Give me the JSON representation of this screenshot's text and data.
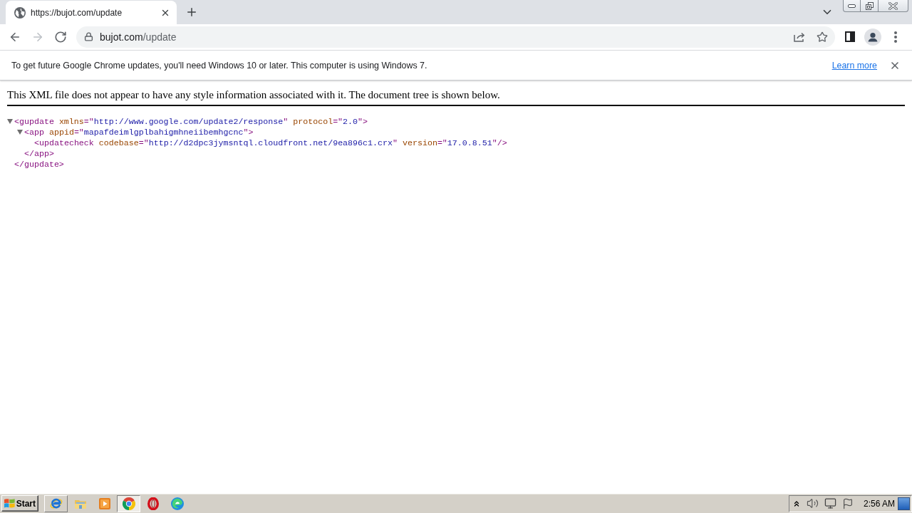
{
  "browser": {
    "tabs": [
      {
        "title": "https://bujot.com/update",
        "selected": true
      }
    ],
    "nav_buttons": [
      {
        "kind": "back",
        "disabled": false
      },
      {
        "kind": "forward",
        "disabled": true
      },
      {
        "kind": "reload",
        "disabled": false
      }
    ],
    "address_bar": {
      "host": "bujot.com",
      "path": "/update"
    }
  },
  "infobar": {
    "message": "To get future Google Chrome updates, you'll need Windows 10 or later. This computer is using Windows 7.",
    "link": "Learn more"
  },
  "page": {
    "notice": "This XML file does not appear to have any style information associated with it. The document tree is shown below.",
    "xml_tree": [
      {
        "expanded": true,
        "open_tag": [
          {
            "kind": "tag",
            "text": "<gupdate"
          },
          {
            "kind": "attr_name",
            "text": " xmlns"
          },
          {
            "kind": "tag",
            "text": "=\""
          },
          {
            "kind": "attr_value",
            "text": "http://www.google.com/update2/response"
          },
          {
            "kind": "tag",
            "text": "\""
          },
          {
            "kind": "attr_name",
            "text": " protocol"
          },
          {
            "kind": "tag",
            "text": "=\""
          },
          {
            "kind": "attr_value",
            "text": "2.0"
          },
          {
            "kind": "tag",
            "text": "\">"
          }
        ],
        "children": [
          {
            "expanded": true,
            "open_tag": [
              {
                "kind": "tag",
                "text": "<app"
              },
              {
                "kind": "attr_name",
                "text": " appid"
              },
              {
                "kind": "tag",
                "text": "=\""
              },
              {
                "kind": "attr_value",
                "text": "mapafdeimlgplbahigmhneiibemhgcnc"
              },
              {
                "kind": "tag",
                "text": "\">"
              }
            ],
            "children": [
              {
                "open_tag": [
                  {
                    "kind": "tag",
                    "text": "<updatecheck"
                  },
                  {
                    "kind": "attr_name",
                    "text": " codebase"
                  },
                  {
                    "kind": "tag",
                    "text": "=\""
                  },
                  {
                    "kind": "attr_value",
                    "text": "http://d2dpc3jymsntql.cloudfront.net/9ea896c1.crx"
                  },
                  {
                    "kind": "tag",
                    "text": "\""
                  },
                  {
                    "kind": "attr_name",
                    "text": " version"
                  },
                  {
                    "kind": "tag",
                    "text": "=\""
                  },
                  {
                    "kind": "attr_value",
                    "text": "17.0.8.51"
                  },
                  {
                    "kind": "tag",
                    "text": "\"/>"
                  }
                ]
              }
            ],
            "close_tag": [
              {
                "kind": "tag",
                "text": "</app>"
              }
            ]
          }
        ],
        "close_tag": [
          {
            "kind": "tag",
            "text": "</gupdate>"
          }
        ]
      }
    ]
  },
  "taskbar": {
    "start_label": "Start",
    "apps": [
      {
        "kind": "ie",
        "hovered": true,
        "selected": false
      },
      {
        "kind": "explorer",
        "hovered": false,
        "selected": false
      },
      {
        "kind": "media",
        "hovered": false,
        "selected": false
      },
      {
        "kind": "chrome",
        "hovered": false,
        "selected": true
      },
      {
        "kind": "opera",
        "hovered": false,
        "selected": false
      },
      {
        "kind": "edge",
        "hovered": false,
        "selected": false
      }
    ],
    "clock": "2:56 AM"
  }
}
